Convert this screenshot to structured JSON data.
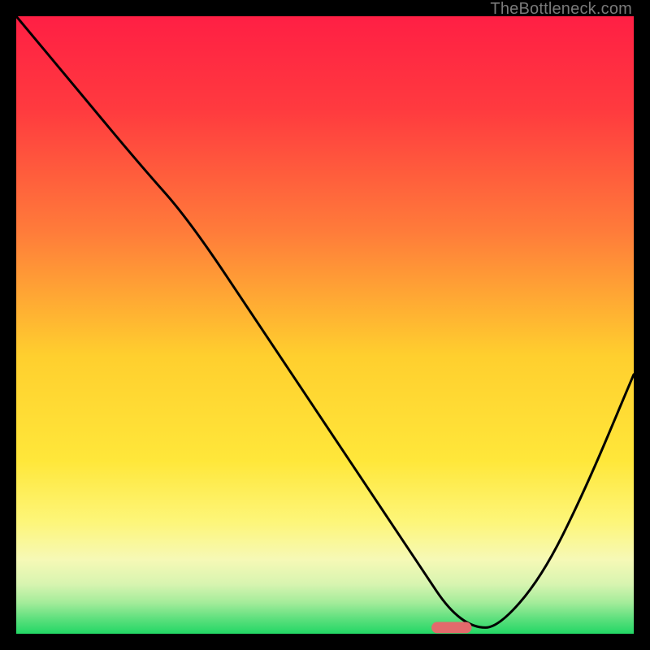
{
  "watermark": "TheBottleneck.com",
  "chart_data": {
    "type": "line",
    "title": "",
    "xlabel": "",
    "ylabel": "",
    "xlim": [
      0,
      100
    ],
    "ylim": [
      0,
      100
    ],
    "gradient_stops": [
      {
        "offset": 0.0,
        "color": "#ff1f44"
      },
      {
        "offset": 0.15,
        "color": "#ff3a3f"
      },
      {
        "offset": 0.35,
        "color": "#ff7c3a"
      },
      {
        "offset": 0.55,
        "color": "#ffcf2e"
      },
      {
        "offset": 0.72,
        "color": "#ffe73a"
      },
      {
        "offset": 0.82,
        "color": "#fdf67a"
      },
      {
        "offset": 0.88,
        "color": "#f6f9b6"
      },
      {
        "offset": 0.92,
        "color": "#d7f4b0"
      },
      {
        "offset": 0.95,
        "color": "#a3ec9a"
      },
      {
        "offset": 0.975,
        "color": "#5fe07e"
      },
      {
        "offset": 1.0,
        "color": "#22d765"
      }
    ],
    "series": [
      {
        "name": "bottleneck-curve",
        "x": [
          0,
          10,
          20,
          28,
          40,
          50,
          60,
          66,
          70,
          74,
          78,
          85,
          92,
          100
        ],
        "y": [
          100,
          88,
          76,
          67,
          49,
          34,
          19,
          10,
          4,
          1,
          1,
          9,
          23,
          42
        ]
      }
    ],
    "marker": {
      "name": "target-pill",
      "x": 70.5,
      "y": 1.0,
      "width": 6.5,
      "height": 1.8,
      "color": "#e36a6c"
    }
  }
}
